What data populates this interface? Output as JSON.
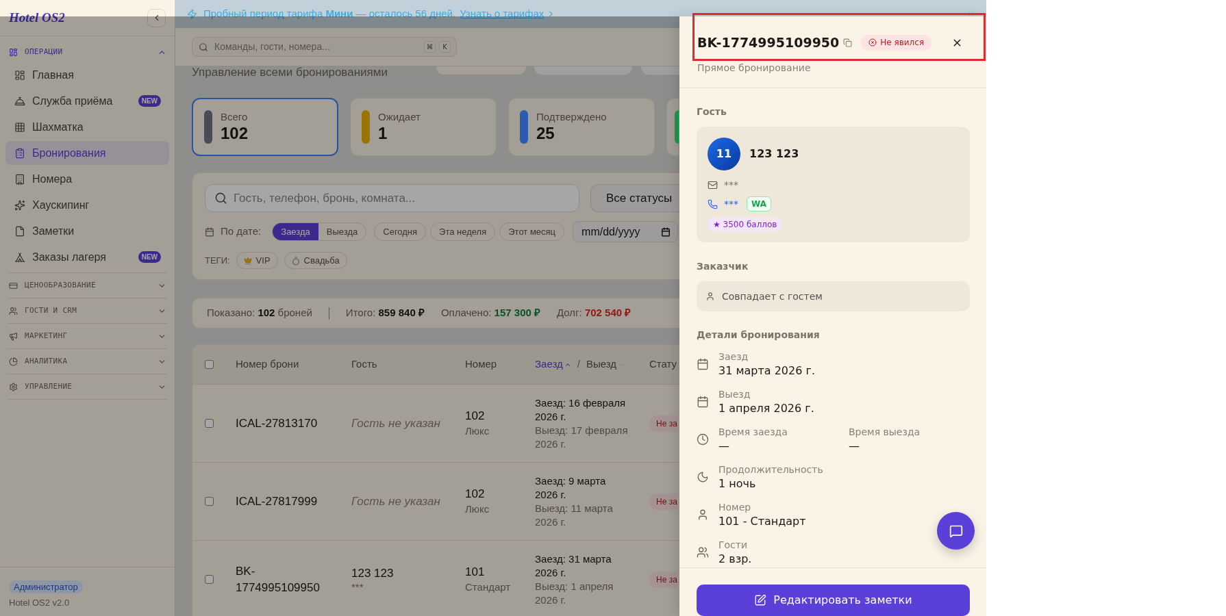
{
  "sidebar": {
    "logo": "Hotel OS2",
    "sections": [
      {
        "title": "ОПЕРАЦИИ",
        "expanded": true,
        "items": [
          {
            "label": "Главная",
            "selected": false
          },
          {
            "label": "Служба приёма",
            "selected": false,
            "badge": "NEW"
          },
          {
            "label": "Шахматка",
            "selected": false
          },
          {
            "label": "Бронирования",
            "selected": true
          },
          {
            "label": "Номера",
            "selected": false
          },
          {
            "label": "Хаускипинг",
            "selected": false
          },
          {
            "label": "Заметки",
            "selected": false
          },
          {
            "label": "Заказы лагеря",
            "selected": false,
            "badge": "NEW"
          }
        ]
      },
      {
        "title": "ЦЕНООБРАЗОВАНИЕ",
        "expanded": false
      },
      {
        "title": "ГОСТИ И CRM",
        "expanded": false
      },
      {
        "title": "МАРКЕТИНГ",
        "expanded": false
      },
      {
        "title": "АНАЛИТИКА",
        "expanded": false
      },
      {
        "title": "УПРАВЛЕНИЕ",
        "expanded": false
      }
    ],
    "role_badge": "Администратор",
    "version": "Hotel OS2 v2.0"
  },
  "banner": {
    "text": "Пробный период тарифа **Мини** — осталось 56 дней.",
    "link": "Узнать о тарифах"
  },
  "header": {
    "search": {
      "placeholder": "Команды, гости, номера..."
    },
    "shortcut_keys": [
      "⌘",
      "K"
    ]
  },
  "page": {
    "subtitle": "Управление всеми бронированиями"
  },
  "stats": [
    {
      "label": "Всего",
      "value": "102",
      "color": "#484c56",
      "selected": true
    },
    {
      "label": "Ожидает",
      "value": "1",
      "color": "#9b7503",
      "selected": false
    },
    {
      "label": "Подтверждено",
      "value": "25",
      "color": "#2b5bb2",
      "selected": false
    },
    {
      "color": "#179048",
      "selected": false
    }
  ],
  "filters": {
    "search": {
      "placeholder": "Гость, телефон, бронь, комната..."
    },
    "status_select": "Все статусы",
    "date_label": "По дате:",
    "date_modes": [
      {
        "label": "Заезда",
        "selected": true
      },
      {
        "label": "Выезда",
        "selected": false
      }
    ],
    "presets": [
      {
        "label": "Сегодня",
        "selected": false
      },
      {
        "label": "Эта неделя",
        "selected": false
      },
      {
        "label": "Этот месяц",
        "selected": false
      }
    ],
    "date_input": {
      "placeholder": "mm/dd/yyyy"
    },
    "tags_label": "ТЕГИ:",
    "tags": [
      {
        "label": "VIP",
        "selected": false
      },
      {
        "label": "Свадьба",
        "selected": false
      }
    ]
  },
  "summary": {
    "shown": "Показано: **102** броней",
    "totals": [
      {
        "kind": "total",
        "label": "Итого:",
        "value": "859 840 ₽"
      },
      {
        "kind": "paid",
        "label": "Оплачено:",
        "value": "157 300 ₽"
      },
      {
        "kind": "debt",
        "label": "Долг:",
        "value": "702 540 ₽"
      }
    ]
  },
  "table": {
    "select_all": {
      "checked": false
    },
    "columns": [
      {
        "kind": "text",
        "label": "Номер брони"
      },
      {
        "kind": "text",
        "label": "Гость"
      },
      {
        "kind": "text",
        "label": "Номер"
      },
      {
        "kind": "sort",
        "options": [
          {
            "label": "Заезд",
            "selected": true
          },
          {
            "label": "Выезд",
            "selected": false
          }
        ],
        "separator": "/"
      },
      {
        "kind": "text",
        "label": "Стату"
      }
    ],
    "rows": [
      {
        "checked": false,
        "id": "ICAL-27813170",
        "guest": {
          "kind": "missing",
          "name": "Гость не указан"
        },
        "room": "102",
        "room_type": "Люкс",
        "checkin": "Заезд: 16 февраля 2026 г.",
        "checkout": "Выезд: 17 февраля 2026 г.",
        "status": "Не за"
      },
      {
        "checked": false,
        "id": "ICAL-27817999",
        "guest": {
          "kind": "missing",
          "name": "Гость не указан"
        },
        "room": "102",
        "room_type": "Люкс",
        "checkin": "Заезд: 9 марта 2026 г.",
        "checkout": "Выезд: 11 марта 2026 г.",
        "status": "Не за"
      },
      {
        "checked": false,
        "id": "BK-1774995109950",
        "guest": {
          "kind": "named",
          "name": "123 123",
          "contact": "***"
        },
        "room": "101",
        "room_type": "Стандарт",
        "checkin": "Заезд: 31 марта 2026 г.",
        "checkout": "Выезд: 1 апреля 2026 г.",
        "status": "Не за"
      }
    ]
  },
  "drawer": {
    "title": "BK-1774995109950",
    "status": "Не явился",
    "subtitle": "Прямое бронирование",
    "guest": {
      "heading": "Гость",
      "initials": "11",
      "name": "123 123",
      "email": "***",
      "phone": "***",
      "messenger": "WA",
      "points": "★ 3500 баллов"
    },
    "customer": {
      "heading": "Заказчик",
      "text": "Совпадает с гостем"
    },
    "details": {
      "heading": "Детали бронирования",
      "rows": [
        {
          "kind": "single",
          "label": "Заезд",
          "value": "31 марта 2026 г."
        },
        {
          "kind": "single",
          "label": "Выезд",
          "value": "1 апреля 2026 г."
        },
        {
          "kind": "pair",
          "items": [
            {
              "label": "Время заезда",
              "value": "—"
            },
            {
              "label": "Время выезда",
              "value": "—"
            }
          ]
        },
        {
          "kind": "single",
          "label": "Продолжительность",
          "value": "1 ночь"
        },
        {
          "kind": "single",
          "label": "Номер",
          "value": "101 - Стандарт"
        },
        {
          "kind": "single",
          "label": "Гости",
          "value": "2 взр."
        }
      ]
    },
    "footer_button": "Редактировать заметки"
  }
}
